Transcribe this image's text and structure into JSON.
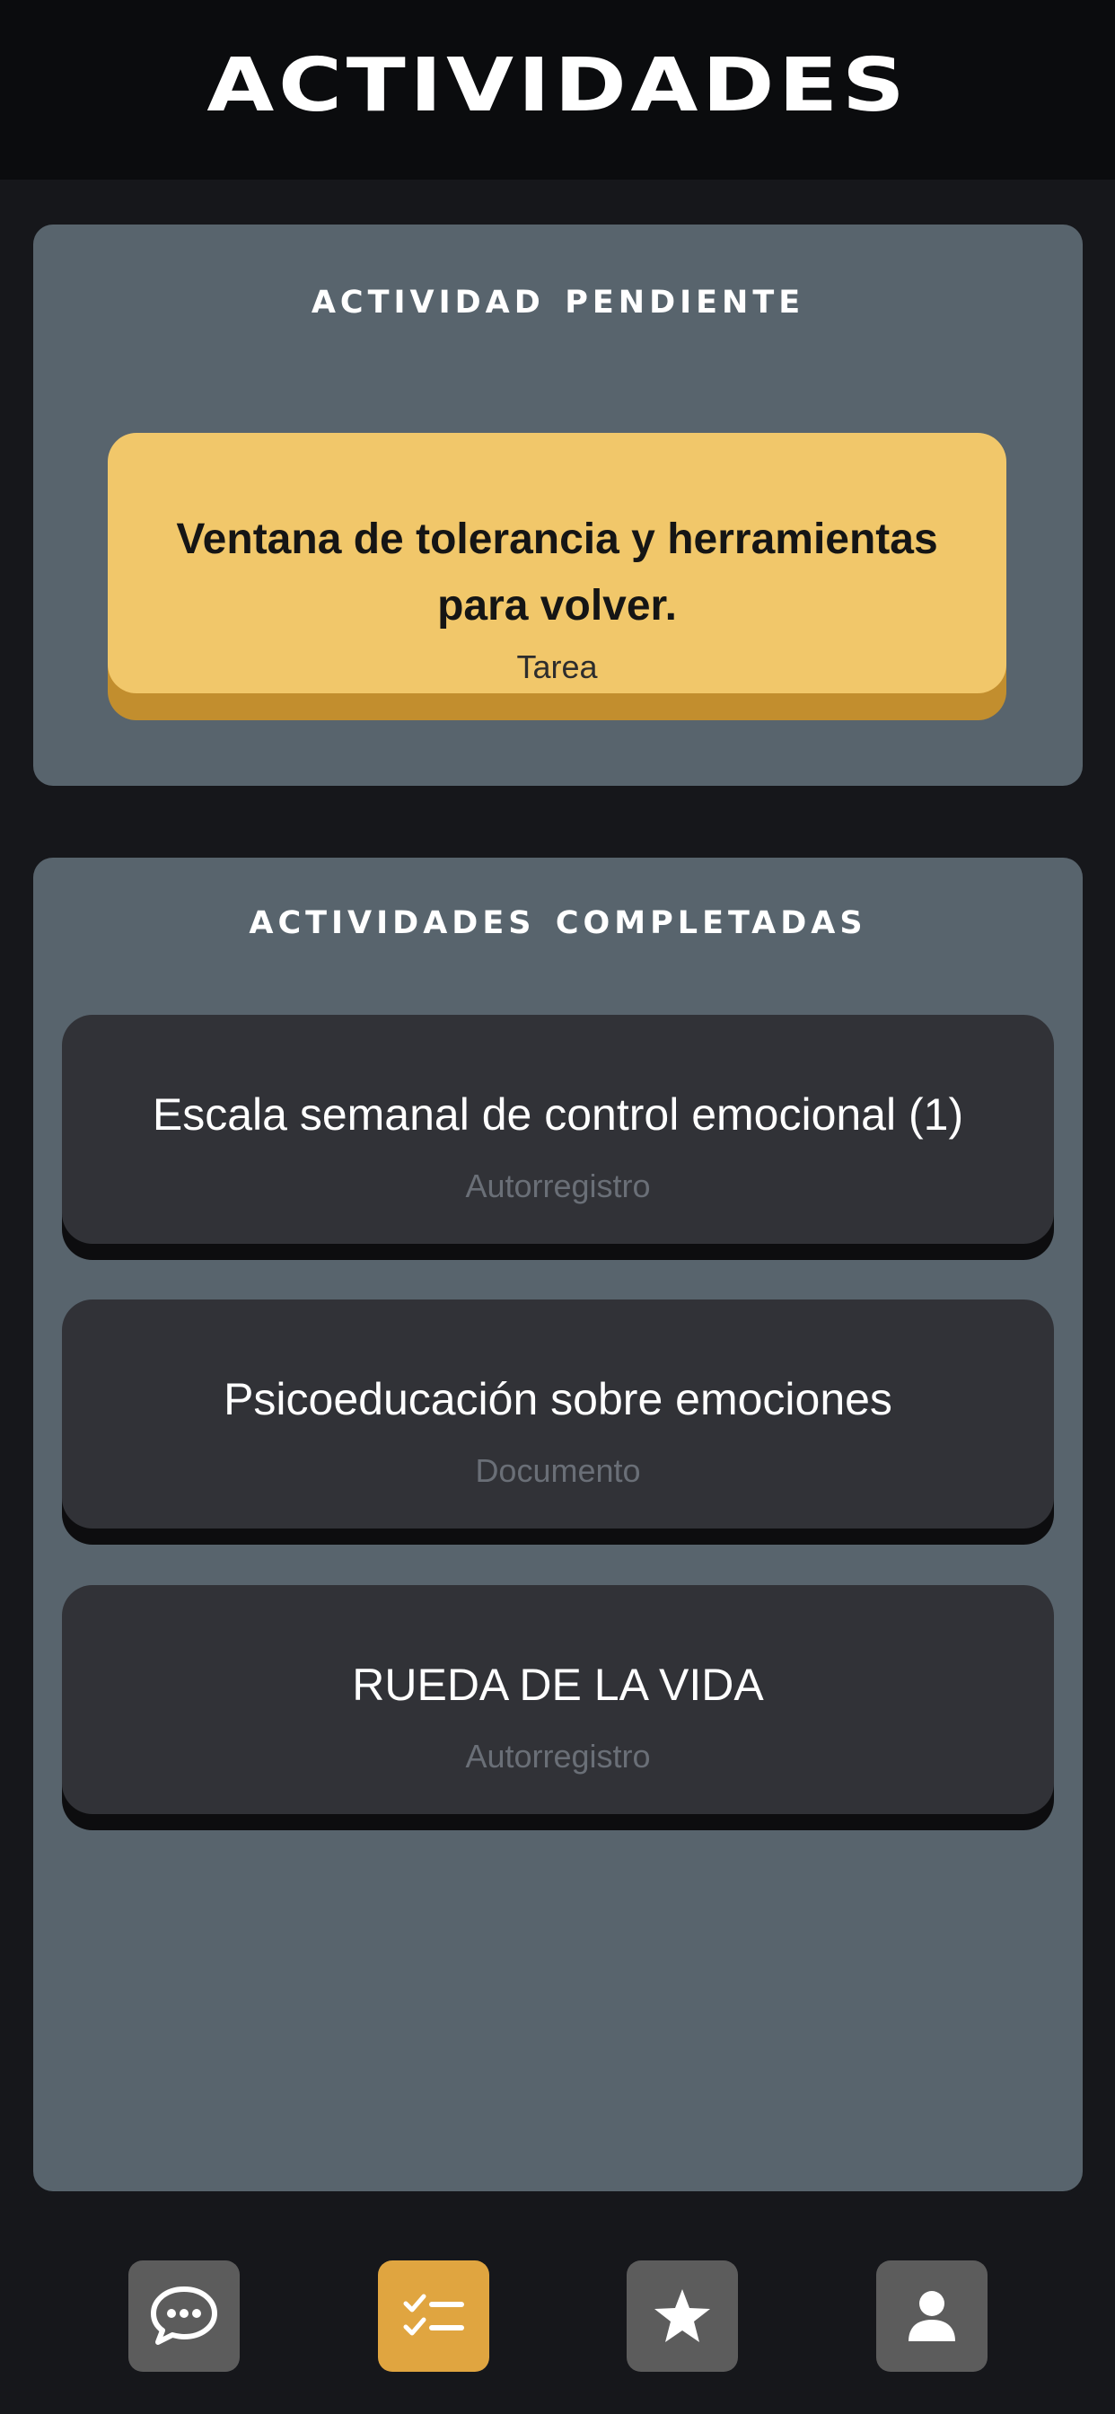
{
  "header": {
    "title": "ACTIVIDADES"
  },
  "pending": {
    "title": "Actividad pendiente",
    "card": {
      "line1": "Ventana de tolerancia y herramientas",
      "line2": "para volver.",
      "type": "Tarea"
    }
  },
  "completed": {
    "title": "Actividades completadas",
    "items": [
      {
        "title": "Escala semanal de control emocional (1)",
        "type": "Autorregistro"
      },
      {
        "title": "Psicoeducación sobre emociones",
        "type": "Documento"
      },
      {
        "title": "RUEDA DE LA VIDA",
        "type": "Autorregistro"
      }
    ]
  },
  "bottom_nav": {
    "active": "activities",
    "items": [
      {
        "id": "chat",
        "icon": "chat-bubble-icon"
      },
      {
        "id": "activities",
        "icon": "checklist-icon"
      },
      {
        "id": "favorites",
        "icon": "star-icon"
      },
      {
        "id": "profile",
        "icon": "user-icon"
      }
    ]
  },
  "colors": {
    "background": "#16171b",
    "header": "#0b0c0e",
    "panel": "#58646d",
    "pending_card": "#f1c76a",
    "completed_card": "#313237",
    "nav_button": "#5c5c5c",
    "nav_active": "#e0a540"
  }
}
